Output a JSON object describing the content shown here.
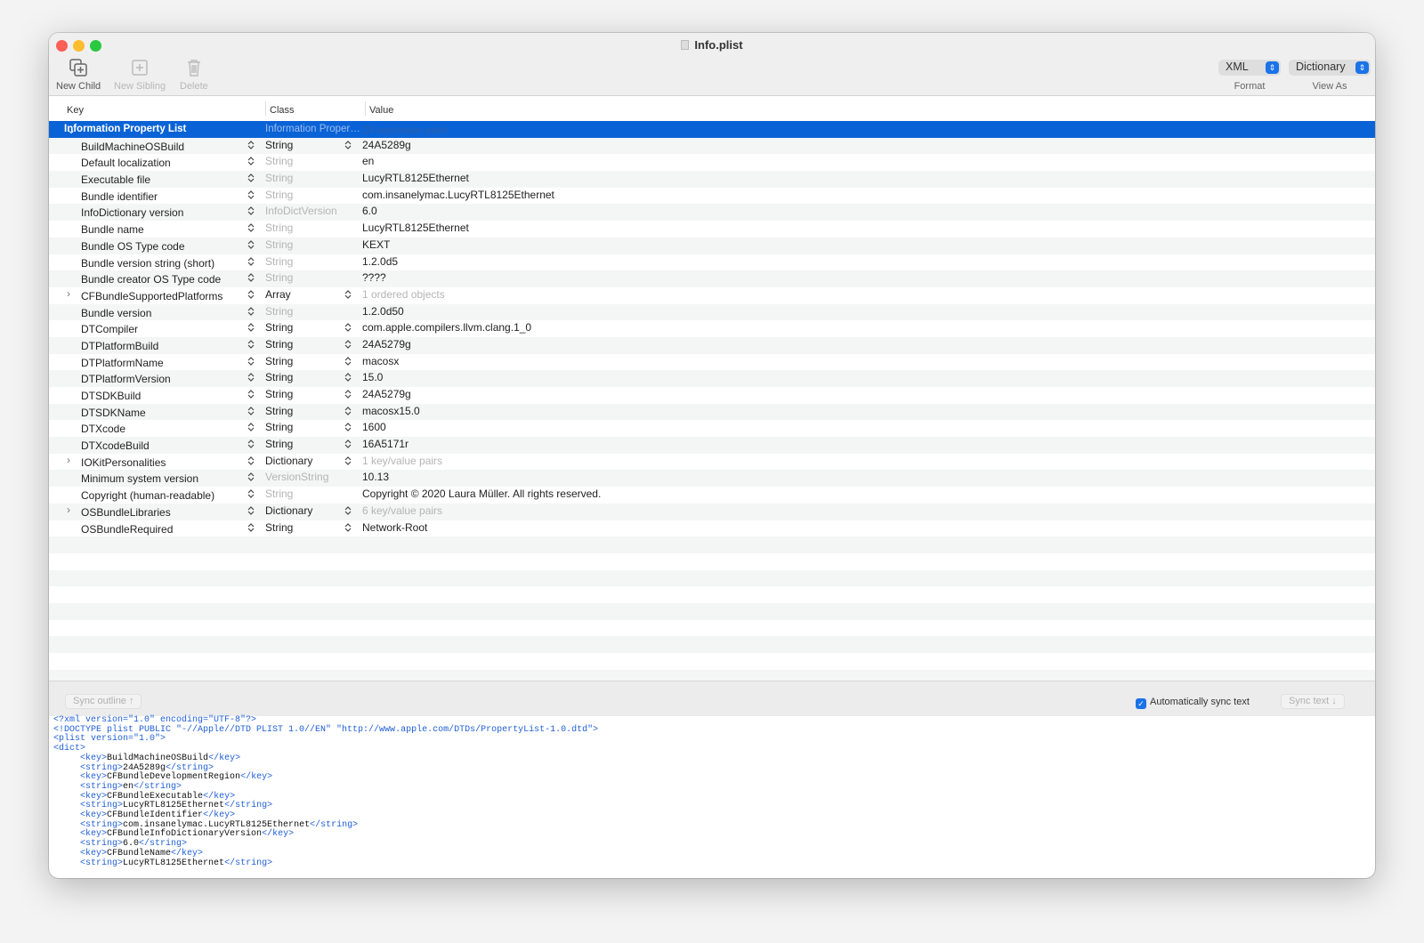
{
  "window": {
    "title": "Info.plist"
  },
  "toolbar": {
    "new_child": "New Child",
    "new_sibling": "New Sibling",
    "delete": "Delete",
    "format_value": "XML",
    "format_label": "Format",
    "view_value": "Dictionary",
    "view_label": "View As"
  },
  "columns": {
    "key": "Key",
    "class": "Class",
    "value": "Value"
  },
  "root": {
    "key": "Information Property List",
    "class": "Information Proper…",
    "value": "24 key/value pairs"
  },
  "rows": [
    {
      "key": "BuildMachineOSBuild",
      "class": "String",
      "value": "24A5289g",
      "ce": true
    },
    {
      "key": "Default localization",
      "class": "String",
      "value": "en",
      "ce": false
    },
    {
      "key": "Executable file",
      "class": "String",
      "value": "LucyRTL8125Ethernet",
      "ce": false
    },
    {
      "key": "Bundle identifier",
      "class": "String",
      "value": "com.insanelymac.LucyRTL8125Ethernet",
      "ce": false
    },
    {
      "key": "InfoDictionary version",
      "class": "InfoDictVersion",
      "value": "6.0",
      "ce": false
    },
    {
      "key": "Bundle name",
      "class": "String",
      "value": "LucyRTL8125Ethernet",
      "ce": false
    },
    {
      "key": "Bundle OS Type code",
      "class": "String",
      "value": "KEXT",
      "ce": false
    },
    {
      "key": "Bundle version string (short)",
      "class": "String",
      "value": "1.2.0d5",
      "ce": false
    },
    {
      "key": "Bundle creator OS Type code",
      "class": "String",
      "value": "????",
      "ce": false
    },
    {
      "key": "CFBundleSupportedPlatforms",
      "class": "Array",
      "value": "1 ordered objects",
      "ce": true,
      "exp": true,
      "vdim": true
    },
    {
      "key": "Bundle version",
      "class": "String",
      "value": "1.2.0d50",
      "ce": false
    },
    {
      "key": "DTCompiler",
      "class": "String",
      "value": "com.apple.compilers.llvm.clang.1_0",
      "ce": true
    },
    {
      "key": "DTPlatformBuild",
      "class": "String",
      "value": "24A5279g",
      "ce": true
    },
    {
      "key": "DTPlatformName",
      "class": "String",
      "value": "macosx",
      "ce": true
    },
    {
      "key": "DTPlatformVersion",
      "class": "String",
      "value": "15.0",
      "ce": true
    },
    {
      "key": "DTSDKBuild",
      "class": "String",
      "value": "24A5279g",
      "ce": true
    },
    {
      "key": "DTSDKName",
      "class": "String",
      "value": "macosx15.0",
      "ce": true
    },
    {
      "key": "DTXcode",
      "class": "String",
      "value": "1600",
      "ce": true
    },
    {
      "key": "DTXcodeBuild",
      "class": "String",
      "value": "16A5171r",
      "ce": true
    },
    {
      "key": "IOKitPersonalities",
      "class": "Dictionary",
      "value": "1 key/value pairs",
      "ce": true,
      "exp": true,
      "vdim": true
    },
    {
      "key": "Minimum system version",
      "class": "VersionString",
      "value": "10.13",
      "ce": false
    },
    {
      "key": "Copyright (human-readable)",
      "class": "String",
      "value": "Copyright © 2020 Laura Müller. All rights reserved.",
      "ce": false
    },
    {
      "key": "OSBundleLibraries",
      "class": "Dictionary",
      "value": "6 key/value pairs",
      "ce": true,
      "exp": true,
      "vdim": true
    },
    {
      "key": "OSBundleRequired",
      "class": "String",
      "value": "Network-Root",
      "ce": true
    }
  ],
  "bottom": {
    "sync_outline": "Sync outline ↑",
    "auto_sync": "Automatically sync text",
    "auto_sync_checked": true,
    "sync_text": "Sync text ↓"
  },
  "xml_lines": [
    "<?xml version=\"1.0\" encoding=\"UTF-8\"?>",
    "<!DOCTYPE plist PUBLIC \"-//Apple//DTD PLIST 1.0//EN\" \"http://www.apple.com/DTDs/PropertyList-1.0.dtd\">",
    "<plist version=\"1.0\">",
    "<dict>",
    "\t<key>BuildMachineOSBuild</key>",
    "\t<string>24A5289g</string>",
    "\t<key>CFBundleDevelopmentRegion</key>",
    "\t<string>en</string>",
    "\t<key>CFBundleExecutable</key>",
    "\t<string>LucyRTL8125Ethernet</string>",
    "\t<key>CFBundleIdentifier</key>",
    "\t<string>com.insanelymac.LucyRTL8125Ethernet</string>",
    "\t<key>CFBundleInfoDictionaryVersion</key>",
    "\t<string>6.0</string>",
    "\t<key>CFBundleName</key>",
    "\t<string>LucyRTL8125Ethernet</string>"
  ]
}
